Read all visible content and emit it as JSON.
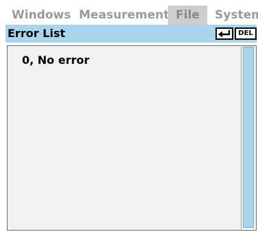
{
  "menu": {
    "items": [
      {
        "label": "Windows"
      },
      {
        "label": "Measurement"
      },
      {
        "label": "File",
        "active": true
      },
      {
        "label": "System"
      }
    ]
  },
  "window": {
    "title": "Error List",
    "enter_icon": "enter-arrow-icon",
    "del_label": "DEL"
  },
  "list": {
    "items": [
      {
        "text": "0, No error"
      }
    ]
  },
  "scrollbar": {
    "visible_fraction": 1.0
  },
  "colors": {
    "title_bar": "#a9d5ec",
    "scroll_thumb": "#a9d5ec",
    "menu_text": "#9a9a9a",
    "menu_active_bg": "#cdcdcd",
    "panel_bg": "#f0f1f2"
  }
}
